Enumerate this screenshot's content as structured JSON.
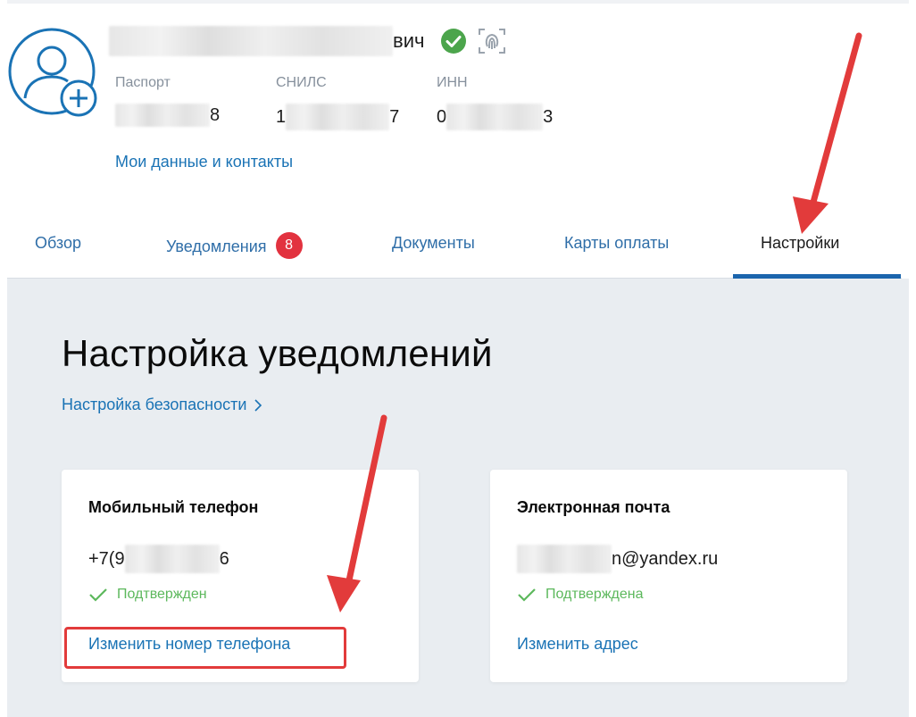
{
  "profile": {
    "name_suffix": "вич",
    "passport_label": "Паспорт",
    "passport_value_end": "8",
    "snils_label": "СНИЛС",
    "snils_value_start": "1",
    "snils_value_end": "7",
    "inn_label": "ИНН",
    "inn_value_start": "0",
    "inn_value_end": "3",
    "my_data_link": "Мои данные и контакты"
  },
  "tabs": [
    {
      "label": "Обзор"
    },
    {
      "label": "Уведомления",
      "badge": "8"
    },
    {
      "label": "Документы"
    },
    {
      "label": "Карты оплаты"
    },
    {
      "label": "Настройки",
      "active": true
    }
  ],
  "main": {
    "title": "Настройка уведомлений",
    "security_link": "Настройка безопасности"
  },
  "cards": [
    {
      "title": "Мобильный телефон",
      "value_start": "+7(9",
      "value_end": "6",
      "status": "Подтвержден",
      "action": "Изменить номер телефона"
    },
    {
      "title": "Электронная почта",
      "value_end": "n@yandex.ru",
      "status": "Подтверждена",
      "action": "Изменить адрес"
    }
  ],
  "colors": {
    "link": "#1a73b5",
    "accent": "#1b65ad",
    "badge": "#e2323f",
    "success": "#5cb85c",
    "annotation": "#e23b3b",
    "background": "#e9edf1"
  },
  "icons": {
    "avatar": "user-add-icon",
    "verified": "check-circle-icon",
    "biometrics": "face-scan-icon",
    "chevron": "chevron-right-icon",
    "status": "check-icon"
  }
}
